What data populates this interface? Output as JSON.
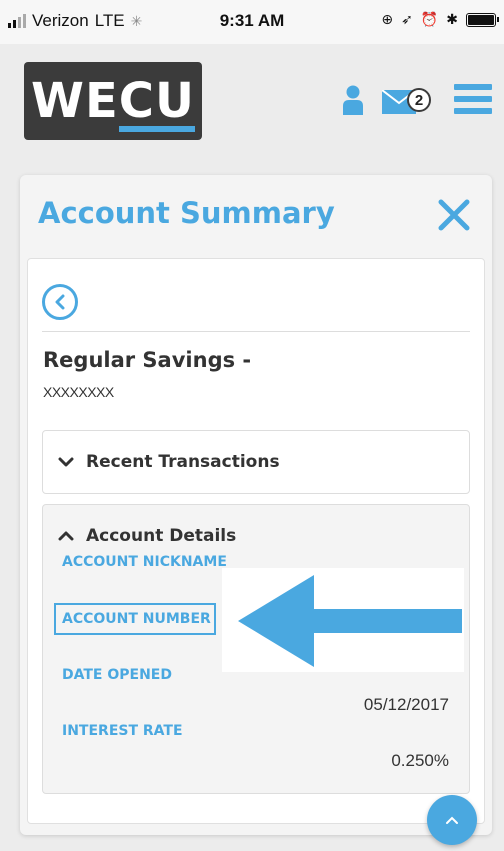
{
  "status_bar": {
    "carrier": "Verizon",
    "network": "LTE",
    "time": "9:31 AM"
  },
  "header": {
    "logo_we": "WE",
    "logo_cu": "CU",
    "mail_badge_count": "2"
  },
  "card": {
    "title": "Account Summary",
    "account_name": "Regular Savings -",
    "account_mask": "XXXXXXXX",
    "recent_transactions_label": "Recent Transactions",
    "account_details_label": "Account Details",
    "fields": {
      "nickname_label": "ACCOUNT NICKNAME",
      "number_label": "ACCOUNT NUMBER",
      "date_opened_label": "DATE OPENED",
      "date_opened_value": "05/12/2017",
      "interest_rate_label": "INTEREST RATE",
      "interest_rate_value": "0.250%"
    }
  },
  "colors": {
    "accent": "#4aa8e0",
    "logo_bg": "#3b3b3b"
  },
  "icons": [
    "user-icon",
    "mail-icon",
    "menu-icon",
    "close-icon",
    "back-arrow-icon",
    "chevron-down-icon",
    "chevron-up-icon",
    "scroll-top-icon"
  ]
}
